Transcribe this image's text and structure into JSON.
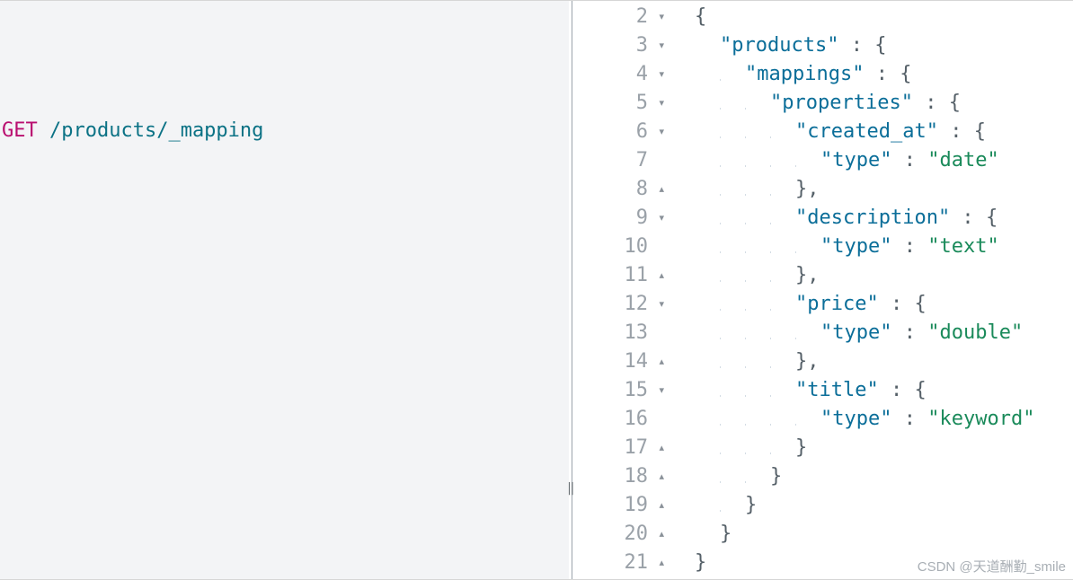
{
  "left": {
    "method": "GET",
    "path": "/products/_mapping"
  },
  "right": {
    "lines": [
      {
        "n": 2,
        "fold": "open",
        "tokens": [
          {
            "t": "punc",
            "v": "{"
          }
        ],
        "indent": 0,
        "guides": 0
      },
      {
        "n": 3,
        "fold": "open",
        "tokens": [
          {
            "t": "key",
            "v": "\"products\""
          },
          {
            "t": "punc",
            "v": " : "
          },
          {
            "t": "punc",
            "v": "{"
          }
        ],
        "indent": 1,
        "guides": 0
      },
      {
        "n": 4,
        "fold": "open",
        "tokens": [
          {
            "t": "key",
            "v": "\"mappings\""
          },
          {
            "t": "punc",
            "v": " : "
          },
          {
            "t": "punc",
            "v": "{"
          }
        ],
        "indent": 2,
        "guides": 1
      },
      {
        "n": 5,
        "fold": "open",
        "tokens": [
          {
            "t": "key",
            "v": "\"properties\""
          },
          {
            "t": "punc",
            "v": " : "
          },
          {
            "t": "punc",
            "v": "{"
          }
        ],
        "indent": 3,
        "guides": 2
      },
      {
        "n": 6,
        "fold": "open",
        "tokens": [
          {
            "t": "key",
            "v": "\"created_at\""
          },
          {
            "t": "punc",
            "v": " : "
          },
          {
            "t": "punc",
            "v": "{"
          }
        ],
        "indent": 4,
        "guides": 3
      },
      {
        "n": 7,
        "fold": "",
        "tokens": [
          {
            "t": "key",
            "v": "\"type\""
          },
          {
            "t": "punc",
            "v": " : "
          },
          {
            "t": "str",
            "v": "\"date\""
          }
        ],
        "indent": 5,
        "guides": 4
      },
      {
        "n": 8,
        "fold": "close",
        "tokens": [
          {
            "t": "punc",
            "v": "},"
          }
        ],
        "indent": 4,
        "guides": 3
      },
      {
        "n": 9,
        "fold": "open",
        "tokens": [
          {
            "t": "key",
            "v": "\"description\""
          },
          {
            "t": "punc",
            "v": " : "
          },
          {
            "t": "punc",
            "v": "{"
          }
        ],
        "indent": 4,
        "guides": 3
      },
      {
        "n": 10,
        "fold": "",
        "tokens": [
          {
            "t": "key",
            "v": "\"type\""
          },
          {
            "t": "punc",
            "v": " : "
          },
          {
            "t": "str",
            "v": "\"text\""
          }
        ],
        "indent": 5,
        "guides": 4
      },
      {
        "n": 11,
        "fold": "close",
        "tokens": [
          {
            "t": "punc",
            "v": "},"
          }
        ],
        "indent": 4,
        "guides": 3
      },
      {
        "n": 12,
        "fold": "open",
        "tokens": [
          {
            "t": "key",
            "v": "\"price\""
          },
          {
            "t": "punc",
            "v": " : "
          },
          {
            "t": "punc",
            "v": "{"
          }
        ],
        "indent": 4,
        "guides": 3
      },
      {
        "n": 13,
        "fold": "",
        "tokens": [
          {
            "t": "key",
            "v": "\"type\""
          },
          {
            "t": "punc",
            "v": " : "
          },
          {
            "t": "str",
            "v": "\"double\""
          }
        ],
        "indent": 5,
        "guides": 4
      },
      {
        "n": 14,
        "fold": "close",
        "tokens": [
          {
            "t": "punc",
            "v": "},"
          }
        ],
        "indent": 4,
        "guides": 3
      },
      {
        "n": 15,
        "fold": "open",
        "tokens": [
          {
            "t": "key",
            "v": "\"title\""
          },
          {
            "t": "punc",
            "v": " : "
          },
          {
            "t": "punc",
            "v": "{"
          }
        ],
        "indent": 4,
        "guides": 3
      },
      {
        "n": 16,
        "fold": "",
        "tokens": [
          {
            "t": "key",
            "v": "\"type\""
          },
          {
            "t": "punc",
            "v": " : "
          },
          {
            "t": "str",
            "v": "\"keyword\""
          }
        ],
        "indent": 5,
        "guides": 4
      },
      {
        "n": 17,
        "fold": "close",
        "tokens": [
          {
            "t": "punc",
            "v": "}"
          }
        ],
        "indent": 4,
        "guides": 3
      },
      {
        "n": 18,
        "fold": "close",
        "tokens": [
          {
            "t": "punc",
            "v": "}"
          }
        ],
        "indent": 3,
        "guides": 2
      },
      {
        "n": 19,
        "fold": "close",
        "tokens": [
          {
            "t": "punc",
            "v": "}"
          }
        ],
        "indent": 2,
        "guides": 1
      },
      {
        "n": 20,
        "fold": "close",
        "tokens": [
          {
            "t": "punc",
            "v": "}"
          }
        ],
        "indent": 1,
        "guides": 0
      },
      {
        "n": 21,
        "fold": "close",
        "tokens": [
          {
            "t": "punc",
            "v": "}"
          }
        ],
        "indent": 0,
        "guides": 0
      }
    ]
  },
  "watermark": "CSDN @天道酬勤_smile"
}
